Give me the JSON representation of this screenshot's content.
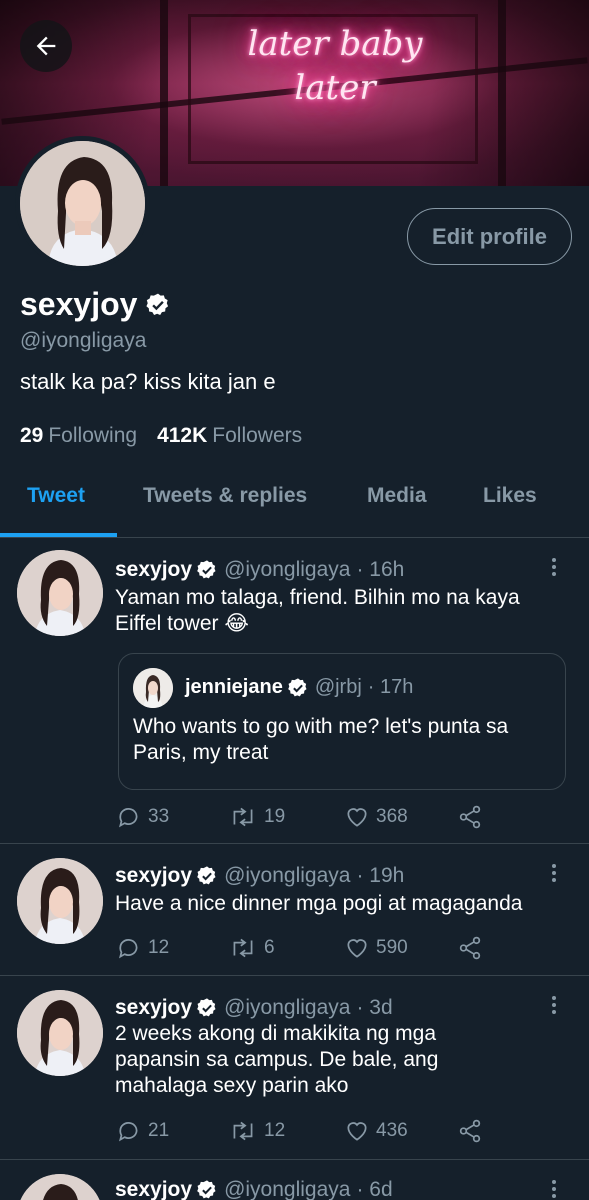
{
  "header": {
    "banner_sign_line1": "later baby",
    "banner_sign_line2": "later",
    "back_icon": "arrow-left-icon"
  },
  "profile": {
    "display_name": "sexyjoy",
    "handle": "@iyongligaya",
    "bio": "stalk ka pa? kiss kita jan e",
    "edit_profile_label": "Edit profile",
    "following_count": "29",
    "following_label": "Following",
    "followers_count": "412K",
    "followers_label": "Followers"
  },
  "tabs": [
    {
      "label": "Tweet",
      "active": true
    },
    {
      "label": "Tweets & replies",
      "active": false
    },
    {
      "label": "Media",
      "active": false
    },
    {
      "label": "Likes",
      "active": false
    }
  ],
  "tweets": [
    {
      "name": "sexyjoy",
      "handle": "@iyongligaya",
      "time": "· 16h",
      "text": "Yaman mo talaga, friend. Bilhin mo na kaya Eiffel tower 😂",
      "quote": {
        "name": "jenniejane",
        "handle": "@jrbj",
        "time": "· 17h",
        "text": "Who wants to go with me? let's punta sa Paris, my treat"
      },
      "replies": "33",
      "retweets": "19",
      "likes": "368"
    },
    {
      "name": "sexyjoy",
      "handle": "@iyongligaya",
      "time": "· 19h",
      "text": "Have a nice dinner mga pogi at magaganda",
      "replies": "12",
      "retweets": "6",
      "likes": "590"
    },
    {
      "name": "sexyjoy",
      "handle": "@iyongligaya",
      "time": "· 3d",
      "text": "2 weeks akong di makikita ng mga papansin sa campus. De bale, ang mahalaga sexy parin ako",
      "replies": "21",
      "retweets": "12",
      "likes": "436"
    },
    {
      "name": "sexyjoy",
      "handle": "@iyongligaya",
      "time": "· 6d"
    }
  ],
  "colors": {
    "background": "#15202b",
    "accent": "#1da1f2",
    "muted": "#8899a6",
    "divider": "#38444d"
  }
}
